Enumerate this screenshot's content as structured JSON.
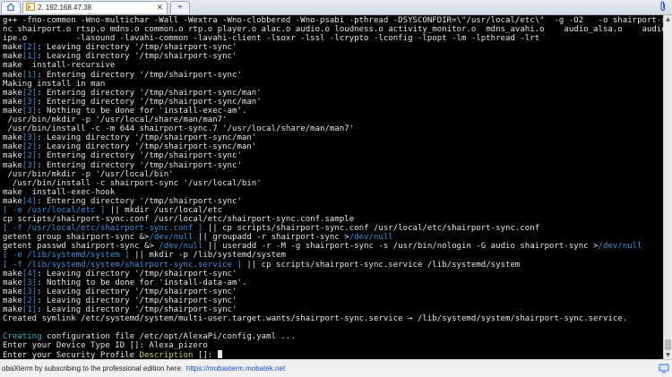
{
  "tabbar": {
    "home_icon": "home-icon",
    "active_tab_label": "2. 192.168.47.38",
    "close_glyph": "✕",
    "new_tab_glyph": "+",
    "attach_icon": "paperclip-icon"
  },
  "terminal": {
    "lines": [
      [
        [
          "w",
          "g++ -fno-common -Wno-multichar -Wall -Wextra -Wno-clobbered -Wno-psabi -pthread -DSYSCONFDIR=\\\"/usr/local/etc\\\"  -g -O2   -o shairport-sy"
        ]
      ],
      [
        [
          "w",
          "nc shairport.o rtsp.o mdns.o common.o rtp.o player.o alac.o audio.o loudness.o activity_monitor.o  mdns_avahi.o    audio_alsa.o    audio_p"
        ]
      ],
      [
        [
          "w",
          "ipe.o          -lasound -lavahi-common -lavahi-client -lsoxr -lssl -lcrypto -lconfig -lpopt -lm -lpthread -lrt"
        ]
      ],
      [
        [
          "w",
          "make"
        ],
        [
          "b",
          "[2]"
        ],
        [
          "w",
          ": Leaving directory '/tmp/shairport-sync'"
        ]
      ],
      [
        [
          "w",
          "make"
        ],
        [
          "b",
          "[1]"
        ],
        [
          "w",
          ": Leaving directory '/tmp/shairport-sync'"
        ]
      ],
      [
        [
          "w",
          "make  install-recursive"
        ]
      ],
      [
        [
          "w",
          "make"
        ],
        [
          "b",
          "[1]"
        ],
        [
          "w",
          ": Entering directory '/tmp/shairport-sync'"
        ]
      ],
      [
        [
          "w",
          "Making install in man"
        ]
      ],
      [
        [
          "w",
          "make"
        ],
        [
          "b",
          "[2]"
        ],
        [
          "w",
          ": Entering directory '/tmp/shairport-sync/man'"
        ]
      ],
      [
        [
          "w",
          "make"
        ],
        [
          "b",
          "[3]"
        ],
        [
          "w",
          ": Entering directory '/tmp/shairport-sync/man'"
        ]
      ],
      [
        [
          "w",
          "make"
        ],
        [
          "b",
          "[3]"
        ],
        [
          "w",
          ": Nothing to be done for 'install-exec-am'."
        ]
      ],
      [
        [
          "w",
          " /usr/bin/mkdir -p '/usr/local/share/man/man7'"
        ]
      ],
      [
        [
          "w",
          " /usr/bin/install -c -m 644 shairport-sync.7 '/usr/local/share/man/man7'"
        ]
      ],
      [
        [
          "w",
          "make"
        ],
        [
          "b",
          "[3]"
        ],
        [
          "w",
          ": Leaving directory '/tmp/shairport-sync/man'"
        ]
      ],
      [
        [
          "w",
          "make"
        ],
        [
          "b",
          "[2]"
        ],
        [
          "w",
          ": Leaving directory '/tmp/shairport-sync/man'"
        ]
      ],
      [
        [
          "w",
          "make"
        ],
        [
          "b",
          "[2]"
        ],
        [
          "w",
          ": Entering directory '/tmp/shairport-sync'"
        ]
      ],
      [
        [
          "w",
          "make"
        ],
        [
          "b",
          "[3]"
        ],
        [
          "w",
          ": Entering directory '/tmp/shairport-sync'"
        ]
      ],
      [
        [
          "w",
          " /usr/bin/mkdir -p '/usr/local/bin'"
        ]
      ],
      [
        [
          "w",
          "  /usr/bin/install -c shairport-sync '/usr/local/bin'"
        ]
      ],
      [
        [
          "w",
          "make  install-exec-hook"
        ]
      ],
      [
        [
          "w",
          "make"
        ],
        [
          "b",
          "[4]"
        ],
        [
          "w",
          ": Entering directory '/tmp/shairport-sync'"
        ]
      ],
      [
        [
          "b",
          "[ -e /usr/local/etc ]"
        ],
        [
          "w",
          " || mkdir /usr/local/etc"
        ]
      ],
      [
        [
          "w",
          "cp scripts/shairport-sync.conf /usr/local/etc/shairport-sync.conf.sample"
        ]
      ],
      [
        [
          "b",
          "[ -f /usr/local/etc/shairport-sync.conf ]"
        ],
        [
          "w",
          " || cp scripts/shairport-sync.conf /usr/local/etc/shairport-sync.conf"
        ]
      ],
      [
        [
          "w",
          "getent group shairport-sync &>"
        ],
        [
          "b",
          "/dev/null"
        ],
        [
          "w",
          " || groupadd -r shairport-sync >"
        ],
        [
          "b",
          "/dev/null"
        ]
      ],
      [
        [
          "w",
          "getent passwd shairport-sync &> "
        ],
        [
          "b",
          "/dev/null"
        ],
        [
          "w",
          " || useradd -r -M -g shairport-sync -s /usr/bin/nologin -G audio shairport-sync >"
        ],
        [
          "b",
          "/dev/null"
        ]
      ],
      [
        [
          "b",
          "[ -e /lib/systemd/system ]"
        ],
        [
          "w",
          " || mkdir -p /lib/systemd/system"
        ]
      ],
      [
        [
          "b",
          "[ -f /lib/systemd/system/shairport-sync.service ]"
        ],
        [
          "w",
          " || cp scripts/shairport-sync.service /lib/systemd/system"
        ]
      ],
      [
        [
          "w",
          "make"
        ],
        [
          "b",
          "[4]"
        ],
        [
          "w",
          ": Leaving directory '/tmp/shairport-sync'"
        ]
      ],
      [
        [
          "w",
          "make"
        ],
        [
          "b",
          "[3]"
        ],
        [
          "w",
          ": Nothing to be done for 'install-data-am'."
        ]
      ],
      [
        [
          "w",
          "make"
        ],
        [
          "b",
          "[3]"
        ],
        [
          "w",
          ": Leaving directory '/tmp/shairport-sync'"
        ]
      ],
      [
        [
          "w",
          "make"
        ],
        [
          "b",
          "[2]"
        ],
        [
          "w",
          ": Leaving directory '/tmp/shairport-sync'"
        ]
      ],
      [
        [
          "w",
          "make"
        ],
        [
          "b",
          "[1]"
        ],
        [
          "w",
          ": Leaving directory '/tmp/shairport-sync'"
        ]
      ],
      [
        [
          "w",
          "Created symlink /etc/systemd/system/multi-user.target.wants/shairport-sync.service → /lib/systemd/system/shairport-sync.service."
        ]
      ],
      [
        [
          "w",
          ""
        ]
      ],
      [
        [
          "s",
          "Creating"
        ],
        [
          "w",
          " configuration file /etc/opt/AlexaPi/config.yaml ..."
        ]
      ],
      [
        [
          "w",
          "Enter your Device Type ID []: Alexa_pizero"
        ]
      ],
      [
        [
          "w",
          "Enter your Security Profile "
        ],
        [
          "y",
          "Description"
        ],
        [
          "w",
          " []: "
        ]
      ]
    ],
    "colors": {
      "w": "#e6e6e6",
      "b": "#3e92dc",
      "s": "#3cb3c9",
      "y": "#d6cf5a"
    }
  },
  "statusbar": {
    "text": "obaXterm by subscribing to the professional edition here:",
    "link": "https://mobaxterm.mobatek.net",
    "icon": "info-icon"
  }
}
